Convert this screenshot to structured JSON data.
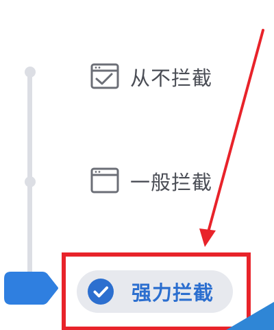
{
  "block_levels": {
    "options": [
      {
        "label": "从不拦截",
        "icon": "checkbox-window-icon",
        "selected": false
      },
      {
        "label": "一般拦截",
        "icon": "window-icon",
        "selected": false
      },
      {
        "label": "强力拦截",
        "icon": "check-circle-icon",
        "selected": true
      }
    ],
    "selected_index": 2
  },
  "colors": {
    "accent_blue": "#2c6fcf",
    "handle_blue": "#2f7fe0",
    "track_gray": "#dcdee4",
    "selected_pill_bg": "#e7e9ee",
    "label_gray": "#4a4d55",
    "annotation_red": "#e8232a"
  }
}
